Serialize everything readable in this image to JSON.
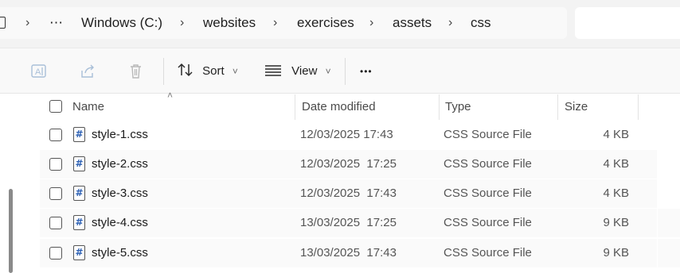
{
  "breadcrumb": {
    "more": "⋯",
    "items": [
      "Windows (C:)",
      "websites",
      "exercises",
      "assets",
      "css"
    ],
    "separator": "›"
  },
  "toolbar": {
    "sort_label": "Sort",
    "view_label": "View",
    "more_label": "•••",
    "dropdown_caret": "˅"
  },
  "columns": {
    "name": "Name",
    "date": "Date modified",
    "type": "Type",
    "size": "Size",
    "sort_indicator": "˄"
  },
  "files": [
    {
      "name": "style-1.css",
      "date": "12/03/2025 17:43",
      "type": "CSS Source File",
      "size": "4 KB"
    },
    {
      "name": "style-2.css",
      "date": "12/03/2025  17:25",
      "type": "CSS Source File",
      "size": "4 KB"
    },
    {
      "name": "style-3.css",
      "date": "12/03/2025  17:43",
      "type": "CSS Source File",
      "size": "4 KB"
    },
    {
      "name": "style-4.css",
      "date": "13/03/2025  17:25",
      "type": "CSS Source File",
      "size": "9 KB"
    },
    {
      "name": "style-5.css",
      "date": "13/03/2025  17:43",
      "type": "CSS Source File",
      "size": "9 KB"
    }
  ],
  "file_icon_glyph": "#",
  "colors": {
    "accent": "#2b5fb3",
    "commandbar": "#f9f9f9",
    "addressbar": "#f3f3f3"
  }
}
